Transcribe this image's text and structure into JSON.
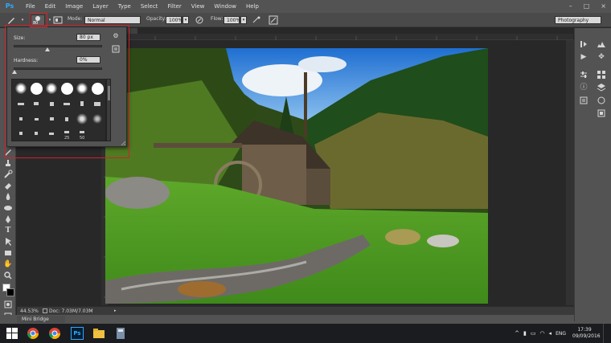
{
  "app": {
    "logo": "Ps",
    "accent": "#31a8ff"
  },
  "menu": {
    "items": [
      "File",
      "Edit",
      "Image",
      "Layer",
      "Type",
      "Select",
      "Filter",
      "View",
      "Window",
      "Help"
    ],
    "window_controls": [
      "–",
      "□",
      "×"
    ]
  },
  "options": {
    "brush_size_preview": "80",
    "mode_label": "Mode:",
    "mode_value": "Normal",
    "opacity_label": "Opacity:",
    "opacity_value": "100%",
    "flow_label": "Flow:",
    "flow_value": "100%",
    "workspace": "Photography"
  },
  "brush_popup": {
    "size_label": "Size:",
    "size_value": "80 px",
    "size_level_pct": 38,
    "hardness_label": "Hardness:",
    "hardness_value": "0%",
    "hardness_level_pct": 0,
    "numbers": [
      "25",
      "50"
    ]
  },
  "status": {
    "zoom": "44.53%",
    "doc": "Doc: 7.03M/7.03M"
  },
  "panels": {
    "mini_bridge": "Mini Bridge"
  },
  "taskbar": {
    "lang": "ENG",
    "time": "17:39",
    "date": "09/09/2016"
  },
  "colors": {
    "foreground": "#ffffff",
    "background": "#000000",
    "highlight": "#d0212a"
  }
}
